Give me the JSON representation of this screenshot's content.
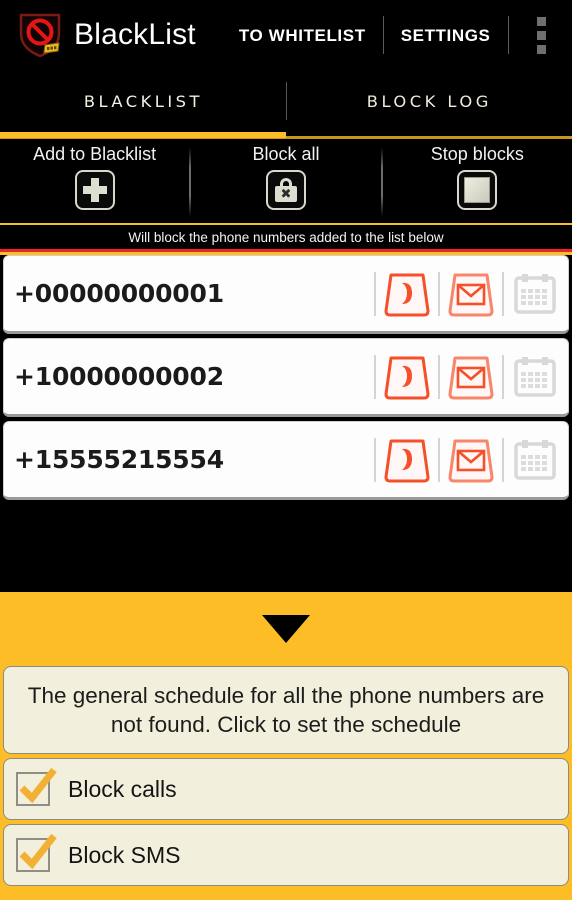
{
  "app": {
    "icon_name": "shield-block-icon",
    "title": "BlackList",
    "accent_orange": "#fcbd26",
    "accent_red": "#e8262a",
    "background": "#000000",
    "card_cream": "#f2f0dd"
  },
  "actionbar": {
    "to_whitelist": "TO WHITELIST",
    "settings": "SETTINGS",
    "overflow_name": "overflow-menu-icon"
  },
  "tabs": [
    {
      "label": "BLACKLIST",
      "active": true
    },
    {
      "label": "BLOCK LOG",
      "active": false
    }
  ],
  "actions": [
    {
      "caption": "Add to Blacklist",
      "icon": "plus-icon"
    },
    {
      "caption": "Block all",
      "icon": "lock-x-icon"
    },
    {
      "caption": "Stop blocks",
      "icon": "stop-square-icon"
    }
  ],
  "banner": {
    "text": "Will block the phone numbers added to the list below"
  },
  "list": {
    "rows": [
      {
        "number": "+00000000001",
        "call_icon": "phone-block-icon",
        "sms_icon": "sms-block-icon",
        "schedule_icon": "calendar-icon",
        "schedule_enabled": false
      },
      {
        "number": "+10000000002",
        "call_icon": "phone-block-icon",
        "sms_icon": "sms-block-icon",
        "schedule_icon": "calendar-icon",
        "schedule_enabled": false
      },
      {
        "number": "+15555215554",
        "call_icon": "phone-block-icon",
        "sms_icon": "sms-block-icon",
        "schedule_icon": "calendar-icon",
        "schedule_enabled": false
      }
    ]
  },
  "footer": {
    "collapse_icon": "caret-down-icon",
    "schedule_text": "The general schedule for all the phone numbers are not found. Click to set the schedule",
    "checkboxes": [
      {
        "label": "Block calls",
        "checked": true
      },
      {
        "label": "Block SMS",
        "checked": true
      }
    ]
  }
}
